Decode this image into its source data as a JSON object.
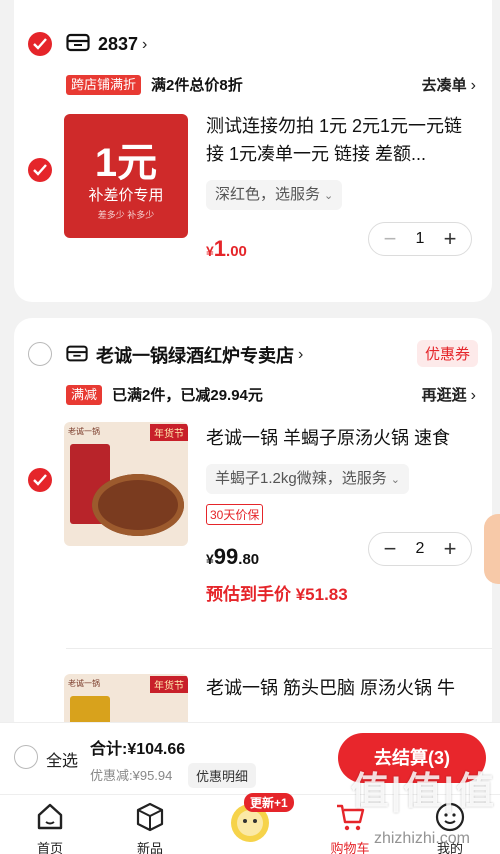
{
  "store1": {
    "name": "2837",
    "promo_tag": "跨店铺满折",
    "promo_text": "满2件总价8折",
    "promo_link": "去凑单",
    "item": {
      "thumb_big": "1元",
      "thumb_sub": "补差价专用",
      "thumb_note": "差多少 补多少",
      "title": "测试连接勿拍 1元 2元1元一元链接 1元凑单一元 链接 差额...",
      "spec": "深红色，选服务",
      "price_currency": "¥",
      "price_int": "1",
      "price_dec": ".00",
      "qty": "1"
    }
  },
  "store2": {
    "name": "老诚一锅绿酒红炉专卖店",
    "coupon": "优惠券",
    "promo_tag": "满减",
    "promo_text": "已满2件，已减29.94元",
    "promo_link": "再逛逛",
    "item1": {
      "thumb_brand": "老诚一锅",
      "thumb_label": "年货节",
      "title": "老诚一锅 羊蝎子原汤火锅 速食",
      "spec": "羊蝎子1.2kg微辣，选服务",
      "badge": "30天价保",
      "price_currency": "¥",
      "price_int": "99",
      "price_dec": ".80",
      "qty": "2",
      "estimate": "预估到手价 ¥51.83"
    },
    "item2": {
      "thumb_brand": "老诚一锅",
      "thumb_label": "年货节",
      "title": "老诚一锅 筋头巴脑 原汤火锅 牛"
    }
  },
  "checkout": {
    "select_all": "全选",
    "total": "合计:¥104.66",
    "discount": "优惠减:¥95.94",
    "detail": "优惠明细",
    "button": "去结算(3)"
  },
  "tabs": [
    {
      "label": "首页",
      "icon": "home-icon"
    },
    {
      "label": "新品",
      "icon": "cube-icon"
    },
    {
      "label": "",
      "icon": "promo-avatar-icon",
      "badge": "更新+1"
    },
    {
      "label": "购物车",
      "icon": "cart-icon"
    },
    {
      "label": "我的",
      "icon": "profile-icon"
    }
  ],
  "watermark": {
    "text": "值|值|值",
    "url": "zhizhizhi.com"
  },
  "colors": {
    "accent": "#e5252a",
    "background": "#f2f2f2"
  }
}
